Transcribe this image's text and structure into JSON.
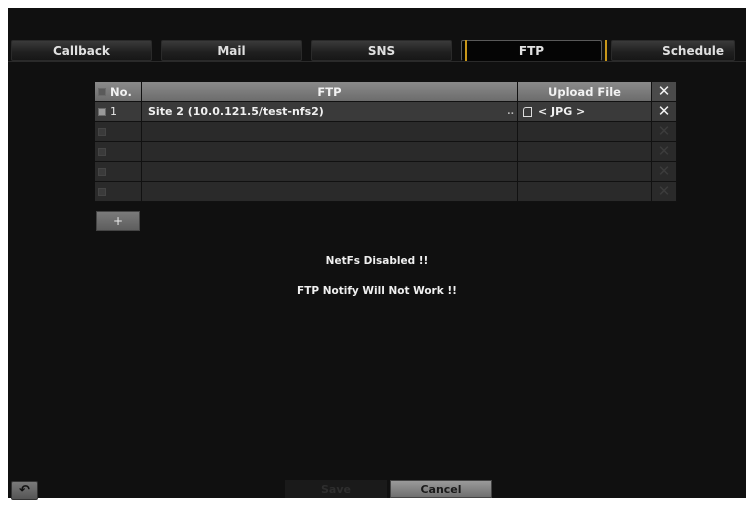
{
  "tabs": [
    "Callback",
    "Mail",
    "SNS",
    "FTP",
    "Schedule"
  ],
  "active_tab": "FTP",
  "table": {
    "headers": {
      "no": "No.",
      "ftp": "FTP",
      "upload": "Upload File"
    },
    "rows": [
      {
        "no": "1",
        "ftp": "Site 2 (10.0.121.5/test-nfs2)",
        "upload": "< JPG >",
        "checked": true
      },
      {
        "no": "",
        "ftp": "",
        "upload": "",
        "checked": false
      },
      {
        "no": "",
        "ftp": "",
        "upload": "",
        "checked": false
      },
      {
        "no": "",
        "ftp": "",
        "upload": "",
        "checked": false
      },
      {
        "no": "",
        "ftp": "",
        "upload": "",
        "checked": false
      }
    ],
    "row1_ellipsis": ".."
  },
  "add_button_label": "+",
  "messages": {
    "line1": "NetFs Disabled !!",
    "line2": "FTP Notify Will Not Work !!"
  },
  "buttons": {
    "save": "Save",
    "cancel": "Cancel"
  },
  "icons": {
    "back": "back-arrow-icon",
    "delete": "close-icon",
    "file": "file-icon"
  }
}
